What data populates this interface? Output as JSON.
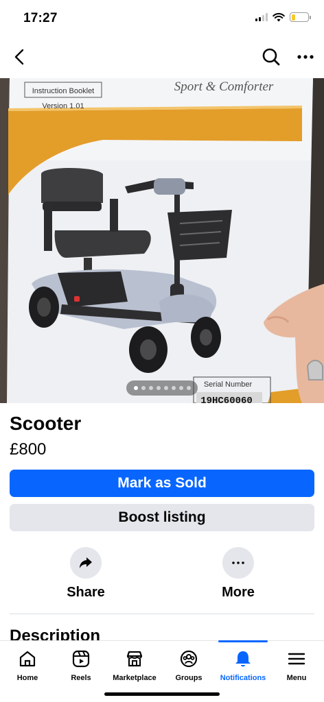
{
  "status_bar": {
    "time": "17:27",
    "battery_level": 0.22,
    "battery_color": "#f7c92a"
  },
  "top_nav": {
    "icons": [
      "back-icon",
      "search-icon",
      "more-horizontal-icon"
    ]
  },
  "photo": {
    "booklet_label": "Instruction Booklet",
    "version_label": "Version 1.01",
    "brand_script": "Sport & Comforter",
    "serial_label": "Serial Number",
    "serial_value": "19HC60060",
    "page_count": 8,
    "current_page": 1
  },
  "listing": {
    "title": "Scooter",
    "price": "£800",
    "mark_sold_label": "Mark as Sold",
    "boost_label": "Boost listing",
    "share_label": "Share",
    "more_label": "More",
    "description_heading": "Description"
  },
  "colors": {
    "primary": "#0866ff",
    "secondary_button": "#e4e6eb"
  },
  "tab_bar": {
    "tabs": [
      {
        "label": "Home",
        "icon": "home-icon"
      },
      {
        "label": "Reels",
        "icon": "reels-icon"
      },
      {
        "label": "Marketplace",
        "icon": "marketplace-icon"
      },
      {
        "label": "Groups",
        "icon": "groups-icon"
      },
      {
        "label": "Notifications",
        "icon": "bell-icon",
        "active": true
      },
      {
        "label": "Menu",
        "icon": "menu-icon"
      }
    ]
  }
}
